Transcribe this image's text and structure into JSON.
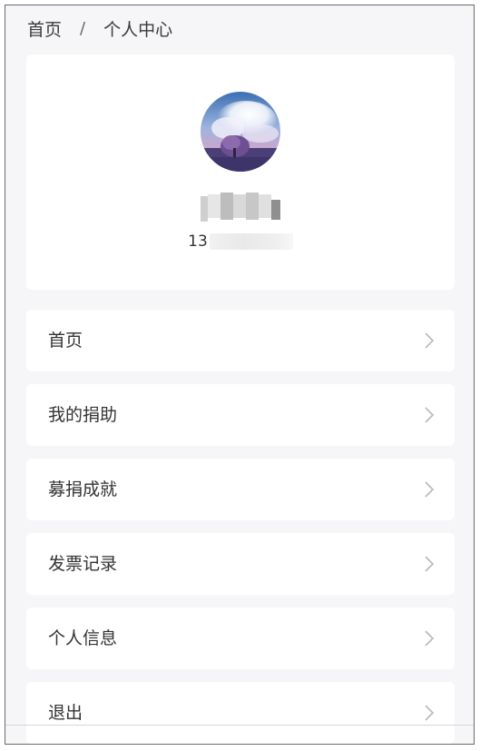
{
  "breadcrumb": {
    "home": "首页",
    "separator": "/",
    "current": "个人中心"
  },
  "profile": {
    "avatar": "avatar-photo",
    "username_masked": "pixelated-username",
    "phone_prefix": "13",
    "phone_masked": "blurred-phone-number"
  },
  "menu": {
    "items": [
      {
        "label": "首页",
        "icon": "chevron-right-icon"
      },
      {
        "label": "我的捐助",
        "icon": "chevron-right-icon"
      },
      {
        "label": "募捐成就",
        "icon": "chevron-right-icon"
      },
      {
        "label": "发票记录",
        "icon": "chevron-right-icon"
      },
      {
        "label": "个人信息",
        "icon": "chevron-right-icon"
      },
      {
        "label": "退出",
        "icon": "chevron-right-icon"
      }
    ]
  },
  "colors": {
    "page_background": "#f6f5f7",
    "card_background": "#ffffff",
    "text": "#333333",
    "chevron": "#b8b8b8"
  }
}
